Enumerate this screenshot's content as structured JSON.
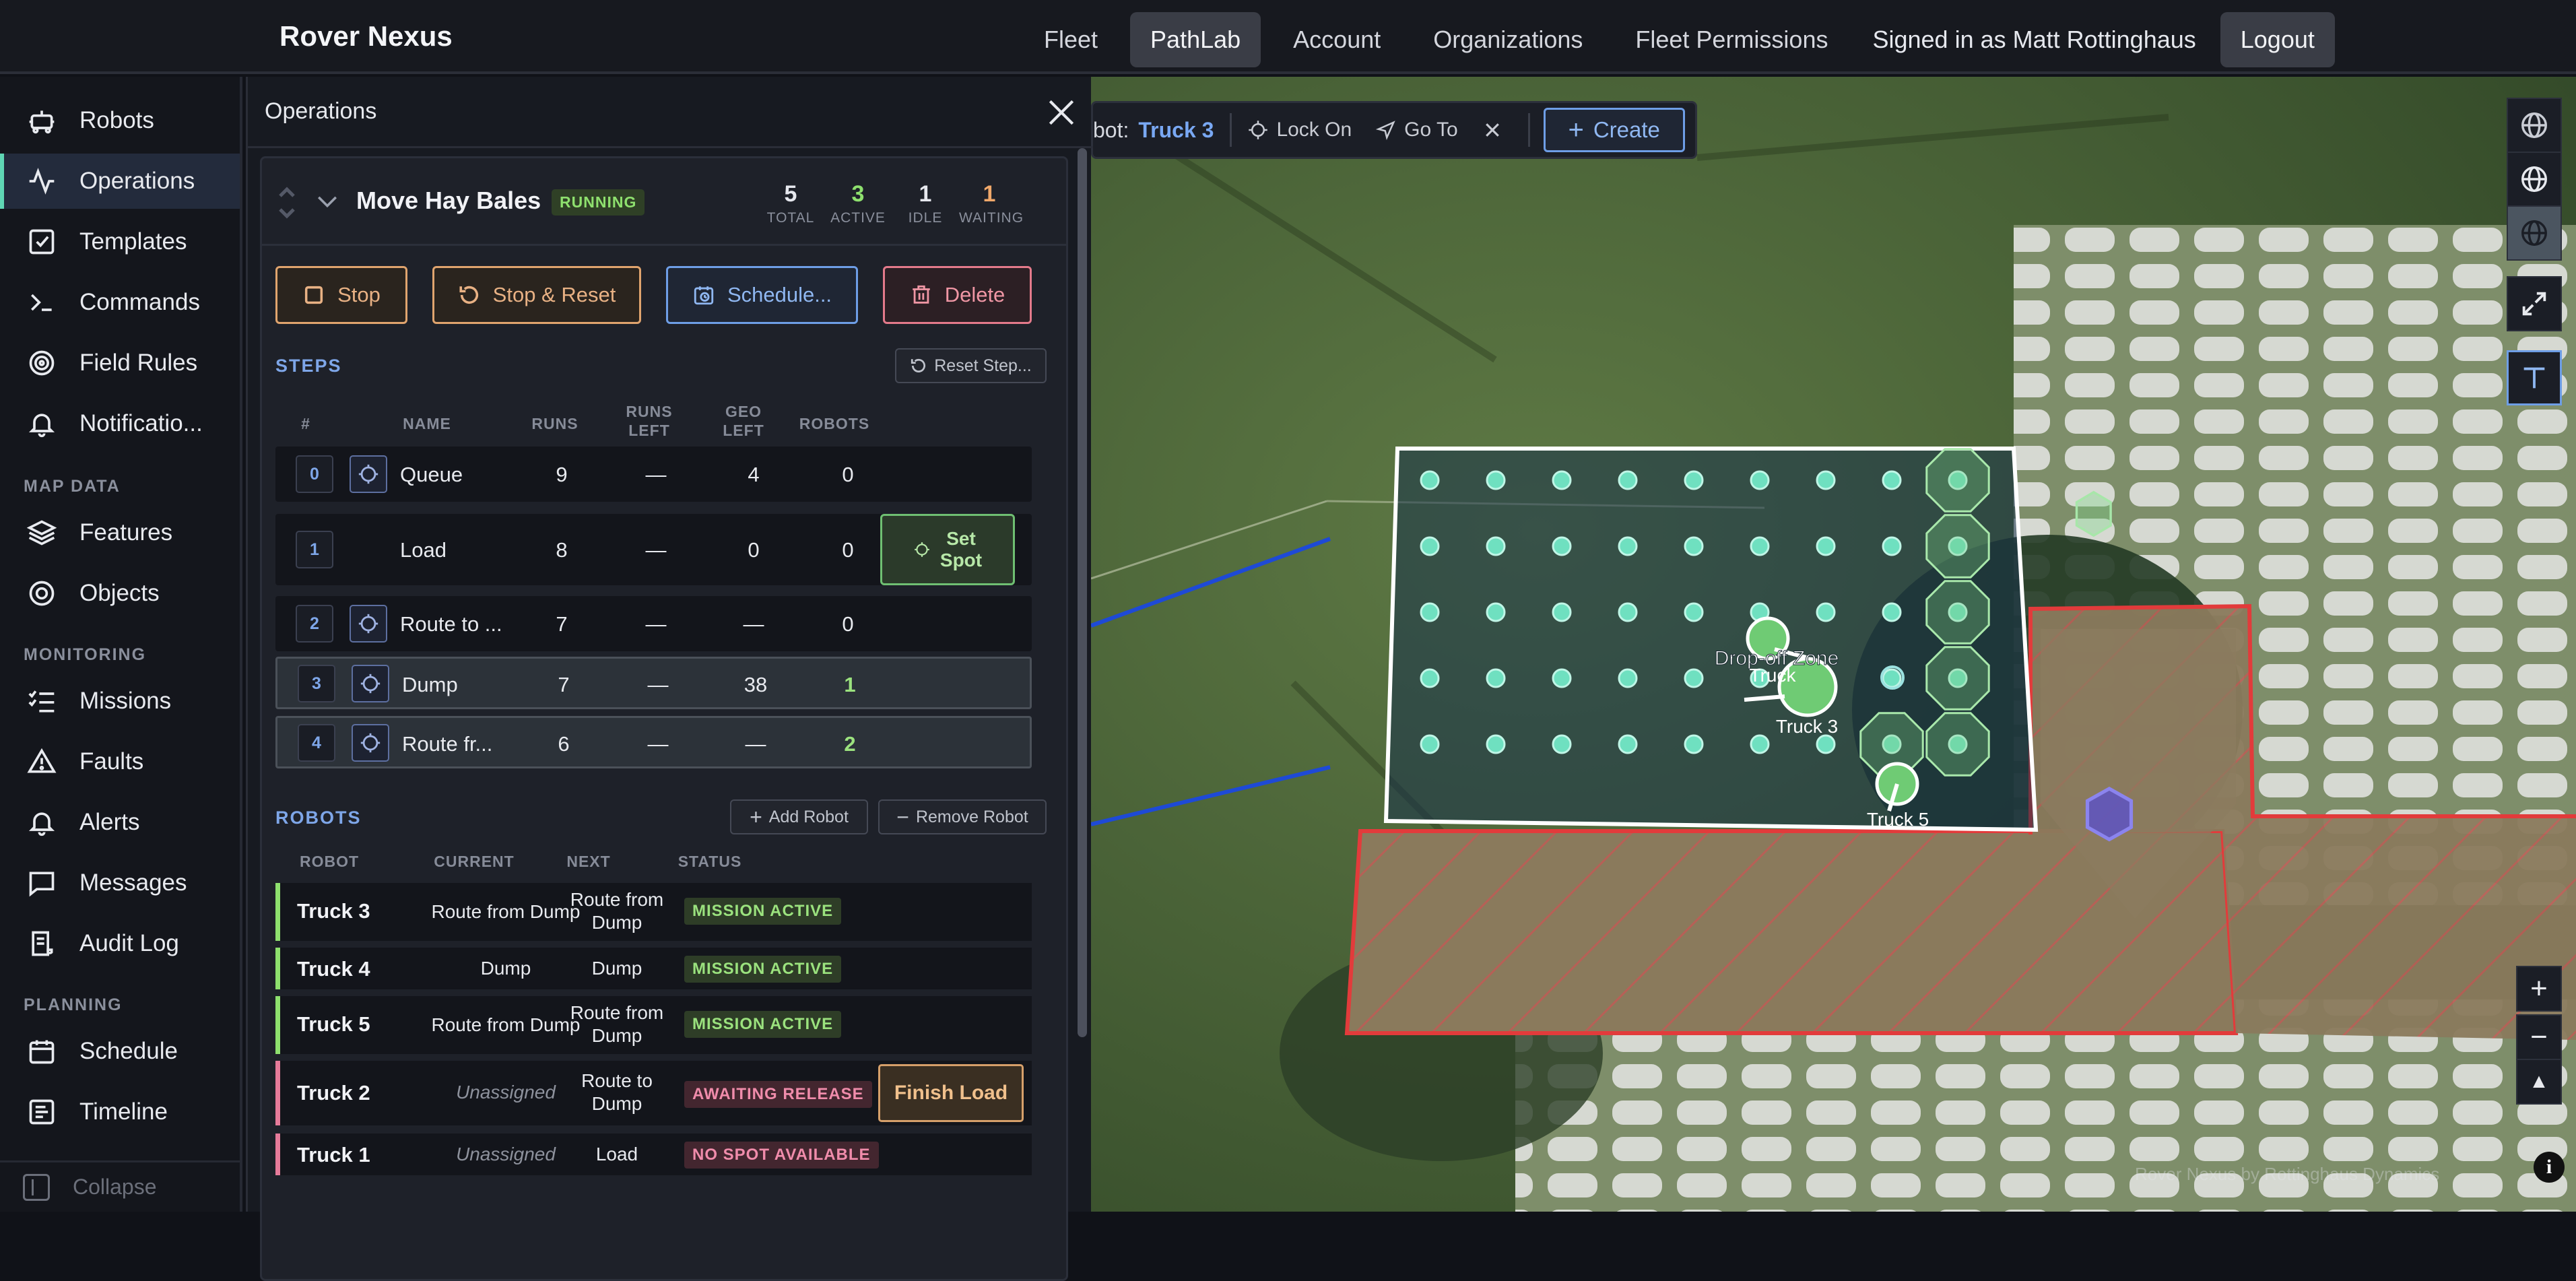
{
  "app": {
    "brand": "Rover Nexus"
  },
  "topnav": {
    "items": [
      "Fleet",
      "PathLab",
      "Account",
      "Organizations",
      "Fleet Permissions"
    ],
    "active": "PathLab",
    "signed_in": "Signed in as Matt Rottinghaus",
    "logout": "Logout"
  },
  "sidebar": {
    "items": [
      {
        "label": "Robots",
        "icon": "robot-icon"
      },
      {
        "label": "Operations",
        "icon": "activity-icon",
        "active": true
      },
      {
        "label": "Templates",
        "icon": "checkbox-icon"
      },
      {
        "label": "Commands",
        "icon": "terminal-icon"
      },
      {
        "label": "Field Rules",
        "icon": "target-icon"
      },
      {
        "label": "Notificatio...",
        "icon": "bell-icon"
      }
    ],
    "map_data_label": "MAP DATA",
    "map_data": [
      {
        "label": "Features",
        "icon": "layers-icon"
      },
      {
        "label": "Objects",
        "icon": "circles-icon"
      }
    ],
    "monitoring_label": "MONITORING",
    "monitoring": [
      {
        "label": "Missions",
        "icon": "list-check-icon"
      },
      {
        "label": "Faults",
        "icon": "warning-icon"
      },
      {
        "label": "Alerts",
        "icon": "bell-icon"
      },
      {
        "label": "Messages",
        "icon": "message-icon"
      },
      {
        "label": "Audit Log",
        "icon": "log-icon"
      }
    ],
    "planning_label": "PLANNING",
    "planning": [
      {
        "label": "Schedule",
        "icon": "calendar-icon"
      },
      {
        "label": "Timeline",
        "icon": "timeline-icon"
      }
    ],
    "collapse": "Collapse"
  },
  "operations": {
    "title": "Operations",
    "mission": {
      "name": "Move Hay Bales",
      "status": "RUNNING",
      "stats": [
        {
          "value": "5",
          "label": "TOTAL",
          "color": "#e6e8ee"
        },
        {
          "value": "3",
          "label": "ACTIVE",
          "color": "#8ee06e"
        },
        {
          "value": "1",
          "label": "IDLE",
          "color": "#e6e8ee"
        },
        {
          "value": "1",
          "label": "WAITING",
          "color": "#f0a86a"
        }
      ]
    },
    "buttons": {
      "stop": "Stop",
      "stop_reset": "Stop & Reset",
      "schedule": "Schedule...",
      "delete": "Delete"
    },
    "steps": {
      "label": "STEPS",
      "reset_step": "Reset Step...",
      "headers": {
        "num": "#",
        "name": "NAME",
        "runs": "RUNS",
        "runs_left_1": "RUNS",
        "runs_left_2": "LEFT",
        "geo_left_1": "GEO",
        "geo_left_2": "LEFT",
        "robots": "ROBOTS"
      },
      "rows": [
        {
          "num": "0",
          "name": "Queue",
          "runs": "9",
          "runs_left": "—",
          "geo_left": "4",
          "robots": "0"
        },
        {
          "num": "1",
          "name": "Load",
          "runs": "8",
          "runs_left": "—",
          "geo_left": "0",
          "robots": "0",
          "action_1": "Set",
          "action_2": "Spot"
        },
        {
          "num": "2",
          "name": "Route to ...",
          "runs": "7",
          "runs_left": "—",
          "geo_left": "—",
          "robots": "0"
        },
        {
          "num": "3",
          "name": "Dump",
          "runs": "7",
          "runs_left": "—",
          "geo_left": "38",
          "robots": "1"
        },
        {
          "num": "4",
          "name": "Route fr...",
          "runs": "6",
          "runs_left": "—",
          "geo_left": "—",
          "robots": "2"
        }
      ]
    },
    "robots": {
      "label": "ROBOTS",
      "add": "Add Robot",
      "remove": "Remove Robot",
      "headers": {
        "robot": "ROBOT",
        "current": "CURRENT",
        "next": "NEXT",
        "status": "STATUS"
      },
      "rows": [
        {
          "robot": "Truck 3",
          "current": "Route from Dump",
          "next_1": "Route from",
          "next_2": "Dump",
          "status": "MISSION ACTIVE"
        },
        {
          "robot": "Truck 4",
          "current": "Dump",
          "next_1": "Dump",
          "next_2": "",
          "status": "MISSION ACTIVE"
        },
        {
          "robot": "Truck 5",
          "current": "Route from Dump",
          "next_1": "Route from",
          "next_2": "Dump",
          "status": "MISSION ACTIVE"
        },
        {
          "robot": "Truck 2",
          "current": "Unassigned",
          "next_1": "Route to",
          "next_2": "Dump",
          "status": "AWAITING RELEASE",
          "action": "Finish Load"
        },
        {
          "robot": "Truck 1",
          "current": "Unassigned",
          "next_1": "Load",
          "next_2": "",
          "status": "NO SPOT AVAILABLE"
        }
      ]
    }
  },
  "map": {
    "toolbar": {
      "robot_prefix": "bot:",
      "robot": "Truck 3",
      "lock_on": "Lock On",
      "go_to": "Go To",
      "create": "Create"
    },
    "labels": {
      "dropoff": "Drop-off Zone",
      "truck_partial": "Truck",
      "truck3": "Truck 3",
      "truck5": "Truck 5"
    },
    "attribution": "Rover Nexus by Rottinghaus Dynamics",
    "zoom": {
      "in": "+",
      "out": "−",
      "north": "▲"
    },
    "info": "i"
  }
}
